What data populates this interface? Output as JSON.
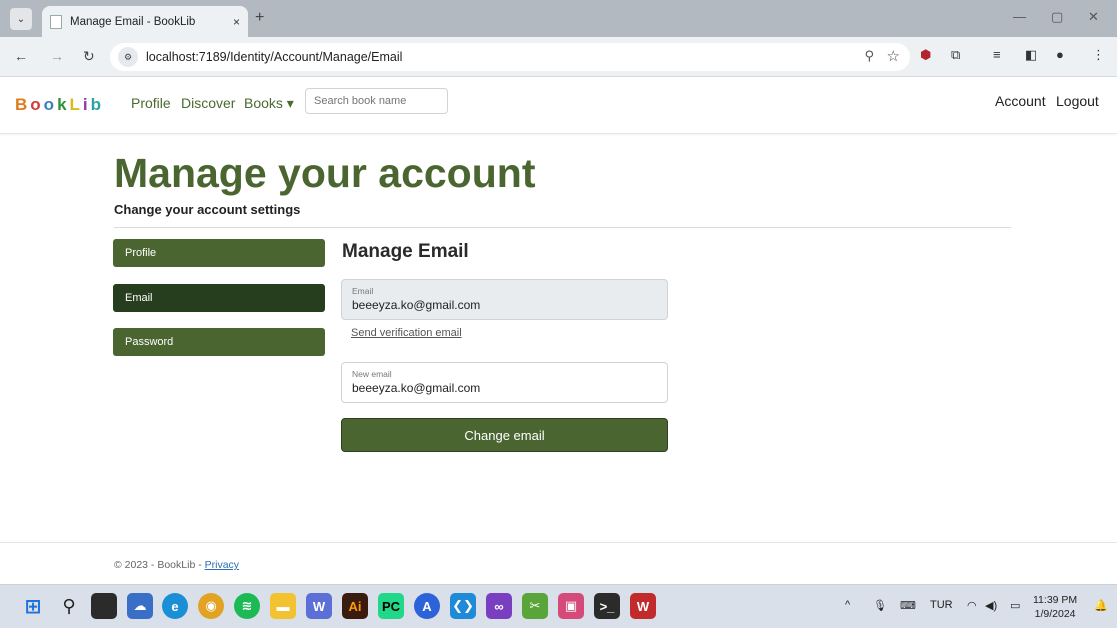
{
  "browser": {
    "tab_title": "Manage Email - BookLib",
    "tab_close": "×",
    "new_tab": "+",
    "url": "localhost:7189/Identity/Account/Manage/Email"
  },
  "site": {
    "brand_letters": [
      "B",
      "o",
      "o",
      "k",
      "L",
      "i",
      "b"
    ],
    "nav": {
      "profile": "Profile",
      "discover": "Discover",
      "books": "Books ▾"
    },
    "search_placeholder": "Search book name",
    "account": "Account",
    "logout": "Logout"
  },
  "page": {
    "title": "Manage your account",
    "subtitle": "Change your account settings",
    "sidebar": [
      {
        "label": "Profile"
      },
      {
        "label": "Email"
      },
      {
        "label": "Password"
      }
    ],
    "section_title": "Manage Email",
    "email_label": "Email",
    "email_value": "beeeyza.ko@gmail.com",
    "verify_link": "Send verification email",
    "new_email_label": "New email",
    "new_email_value": "beeeyza.ko@gmail.com",
    "submit": "Change email"
  },
  "footer": {
    "text": "© 2023 - BookLib - ",
    "privacy": "Privacy"
  },
  "taskbar": {
    "language": "TUR",
    "time": "11:39 PM",
    "date": "1/9/2024"
  }
}
